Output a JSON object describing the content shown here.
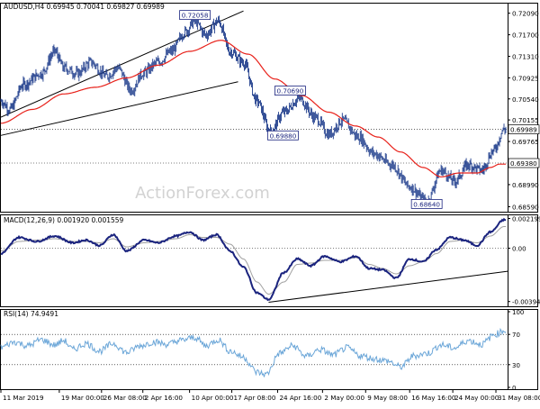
{
  "colors": {
    "candle": "#1f3d8c",
    "ma": "#e8211a",
    "macd": "#1a237e",
    "signal": "#a0a0a0",
    "rsi": "#6ba6d8",
    "channel": "#000000",
    "label_border": "#1a237e",
    "label_text": "#1a237e",
    "axis": "#000000",
    "grid_dash": "#000000",
    "watermark": "#d2d2d2"
  },
  "icons": [
    "none"
  ],
  "chart_data": [
    {
      "type": "candlestick",
      "title": "AUDUSD,H4  0.69945 0.70041 0.69827 0.69989",
      "watermark": "ActionForex.com",
      "yrange": [
        0.685,
        0.7228
      ],
      "ytick_values": [
        0.7209,
        0.717,
        0.7131,
        0.7092,
        0.7054,
        0.7016,
        0.6977,
        0.6938,
        0.6899,
        0.6859
      ],
      "ytick_labels": [
        "0.72090",
        "0.71700",
        "0.71310",
        "0.70925",
        "0.70540",
        "0.70155",
        "0.69765",
        "0.69380",
        "0.68990",
        "0.68590"
      ],
      "last_price": {
        "value": 0.69989,
        "label": "0.69989"
      },
      "ref_price": {
        "value": 0.6938,
        "label": "0.69380"
      },
      "price_labels": [
        {
          "text": "0.72058",
          "value": 0.72058,
          "bar": 216
        },
        {
          "text": "0.70690",
          "value": 0.7069,
          "bar": 322
        },
        {
          "text": "0.69880",
          "value": 0.6988,
          "bar": 314
        },
        {
          "text": "0.68640",
          "value": 0.6864,
          "bar": 474
        }
      ],
      "channel_lines": [
        {
          "from": [
            0,
            0.7021
          ],
          "to": [
            270,
            0.7213
          ]
        },
        {
          "from": [
            0,
            0.6988
          ],
          "to": [
            264,
            0.7085
          ]
        }
      ],
      "moving_average_anchors": [
        [
          0,
          0.701
        ],
        [
          35,
          0.7035
        ],
        [
          70,
          0.7063
        ],
        [
          105,
          0.7075
        ],
        [
          140,
          0.7092
        ],
        [
          175,
          0.7115
        ],
        [
          210,
          0.714
        ],
        [
          245,
          0.716
        ],
        [
          275,
          0.7135
        ],
        [
          305,
          0.709
        ],
        [
          335,
          0.706
        ],
        [
          365,
          0.703
        ],
        [
          395,
          0.7005
        ],
        [
          420,
          0.6985
        ],
        [
          445,
          0.6958
        ],
        [
          470,
          0.693
        ],
        [
          490,
          0.6913
        ],
        [
          510,
          0.692
        ],
        [
          530,
          0.692
        ],
        [
          545,
          0.693
        ],
        [
          555,
          0.6936
        ]
      ],
      "price_anchors": [
        [
          0,
          0.705
        ],
        [
          10,
          0.7035
        ],
        [
          25,
          0.708
        ],
        [
          45,
          0.71
        ],
        [
          60,
          0.714
        ],
        [
          70,
          0.711
        ],
        [
          85,
          0.71
        ],
        [
          100,
          0.712
        ],
        [
          118,
          0.7095
        ],
        [
          130,
          0.711
        ],
        [
          145,
          0.707
        ],
        [
          158,
          0.71
        ],
        [
          175,
          0.712
        ],
        [
          190,
          0.714
        ],
        [
          205,
          0.7175
        ],
        [
          216,
          0.7195
        ],
        [
          228,
          0.717
        ],
        [
          242,
          0.7195
        ],
        [
          255,
          0.714
        ],
        [
          270,
          0.712
        ],
        [
          285,
          0.705
        ],
        [
          300,
          0.6995
        ],
        [
          315,
          0.703
        ],
        [
          332,
          0.7055
        ],
        [
          350,
          0.702
        ],
        [
          365,
          0.699
        ],
        [
          380,
          0.7015
        ],
        [
          398,
          0.6985
        ],
        [
          415,
          0.6955
        ],
        [
          435,
          0.6935
        ],
        [
          455,
          0.6895
        ],
        [
          474,
          0.6868
        ],
        [
          490,
          0.6925
        ],
        [
          505,
          0.6905
        ],
        [
          520,
          0.6935
        ],
        [
          535,
          0.6925
        ],
        [
          548,
          0.696
        ],
        [
          560,
          0.6999
        ]
      ]
    },
    {
      "type": "line",
      "title": "MACD(12,26,9) 0.001920 0.001559",
      "yrange": [
        -0.0043,
        0.0025
      ],
      "ytick_values": [
        0.002199,
        0.0,
        -0.003948
      ],
      "ytick_labels": [
        "0.002199",
        "0.00",
        "-0.003948"
      ],
      "macd_anchors": [
        [
          0,
          -0.0004
        ],
        [
          20,
          0.0008
        ],
        [
          40,
          0.0005
        ],
        [
          60,
          0.0009
        ],
        [
          80,
          0.0004
        ],
        [
          95,
          0.0006
        ],
        [
          110,
          0.0002
        ],
        [
          125,
          0.001
        ],
        [
          140,
          -0.0002
        ],
        [
          160,
          0.0006
        ],
        [
          175,
          0.0004
        ],
        [
          195,
          0.0009
        ],
        [
          210,
          0.0012
        ],
        [
          225,
          0.0006
        ],
        [
          240,
          0.001
        ],
        [
          255,
          -0.0002
        ],
        [
          270,
          -0.0014
        ],
        [
          285,
          -0.0033
        ],
        [
          298,
          -0.0038
        ],
        [
          315,
          -0.0018
        ],
        [
          330,
          -0.0008
        ],
        [
          345,
          -0.0013
        ],
        [
          360,
          -0.0006
        ],
        [
          378,
          -0.001
        ],
        [
          395,
          -0.0006
        ],
        [
          410,
          -0.0015
        ],
        [
          425,
          -0.0016
        ],
        [
          440,
          -0.0022
        ],
        [
          455,
          -0.0008
        ],
        [
          470,
          -0.001
        ],
        [
          485,
          -0.0001
        ],
        [
          500,
          0.0008
        ],
        [
          515,
          0.0006
        ],
        [
          530,
          0.0002
        ],
        [
          545,
          0.0012
        ],
        [
          560,
          0.0021
        ]
      ],
      "signal_anchors": [
        [
          0,
          -0.0002
        ],
        [
          20,
          0.0005
        ],
        [
          40,
          0.0006
        ],
        [
          60,
          0.0007
        ],
        [
          80,
          0.0005
        ],
        [
          95,
          0.0005
        ],
        [
          110,
          0.0004
        ],
        [
          125,
          0.0007
        ],
        [
          140,
          0.0001
        ],
        [
          160,
          0.0004
        ],
        [
          175,
          0.0005
        ],
        [
          195,
          0.0007
        ],
        [
          210,
          0.001
        ],
        [
          225,
          0.0008
        ],
        [
          240,
          0.0008
        ],
        [
          255,
          0.0003
        ],
        [
          270,
          -0.0008
        ],
        [
          285,
          -0.0025
        ],
        [
          298,
          -0.0034
        ],
        [
          315,
          -0.0025
        ],
        [
          330,
          -0.0012
        ],
        [
          345,
          -0.0011
        ],
        [
          360,
          -0.0009
        ],
        [
          378,
          -0.0009
        ],
        [
          395,
          -0.0007
        ],
        [
          410,
          -0.0012
        ],
        [
          425,
          -0.0015
        ],
        [
          440,
          -0.0019
        ],
        [
          455,
          -0.0013
        ],
        [
          470,
          -0.001
        ],
        [
          485,
          -0.0004
        ],
        [
          500,
          0.0005
        ],
        [
          515,
          0.0006
        ],
        [
          530,
          0.0004
        ],
        [
          545,
          0.0009
        ],
        [
          560,
          0.0016
        ]
      ],
      "trendline": {
        "from": [
          298,
          -0.004
        ],
        "to": [
          565,
          -0.0017
        ]
      }
    },
    {
      "type": "line",
      "title": "RSI(14) 74.9491",
      "yrange": [
        0,
        100
      ],
      "ytick_values": [
        100,
        70,
        30,
        0
      ],
      "ytick_labels": [
        "100",
        "70",
        "30",
        "0"
      ],
      "rsi_anchors": [
        [
          0,
          53
        ],
        [
          15,
          60
        ],
        [
          30,
          55
        ],
        [
          45,
          63
        ],
        [
          60,
          56
        ],
        [
          70,
          62
        ],
        [
          80,
          50
        ],
        [
          95,
          58
        ],
        [
          110,
          48
        ],
        [
          125,
          58
        ],
        [
          140,
          46
        ],
        [
          155,
          55
        ],
        [
          170,
          60
        ],
        [
          185,
          57
        ],
        [
          200,
          62
        ],
        [
          216,
          66
        ],
        [
          228,
          55
        ],
        [
          242,
          63
        ],
        [
          255,
          48
        ],
        [
          270,
          40
        ],
        [
          285,
          20
        ],
        [
          295,
          17
        ],
        [
          310,
          45
        ],
        [
          325,
          55
        ],
        [
          340,
          41
        ],
        [
          355,
          50
        ],
        [
          370,
          43
        ],
        [
          385,
          52
        ],
        [
          400,
          42
        ],
        [
          415,
          38
        ],
        [
          430,
          35
        ],
        [
          445,
          27
        ],
        [
          460,
          42
        ],
        [
          475,
          45
        ],
        [
          490,
          56
        ],
        [
          505,
          52
        ],
        [
          520,
          62
        ],
        [
          535,
          57
        ],
        [
          550,
          70
        ],
        [
          560,
          75
        ]
      ]
    }
  ],
  "x_axis": {
    "labels": [
      {
        "text": "11 Mar 2019",
        "bar": 0
      },
      {
        "text": "19 Mar 00:00",
        "bar": 65
      },
      {
        "text": "26 Mar 08:00",
        "bar": 112
      },
      {
        "text": "2 Apr 16:00",
        "bar": 158
      },
      {
        "text": "10 Apr 00:00",
        "bar": 210
      },
      {
        "text": "17 Apr 08:00",
        "bar": 257
      },
      {
        "text": "24 Apr 16:00",
        "bar": 308
      },
      {
        "text": "2 May 00:00",
        "bar": 358
      },
      {
        "text": "9 May 08:00",
        "bar": 406
      },
      {
        "text": "16 May 16:00",
        "bar": 455
      },
      {
        "text": "24 May 00:00",
        "bar": 503
      },
      {
        "text": "31 May 08:00",
        "bar": 551
      }
    ]
  }
}
